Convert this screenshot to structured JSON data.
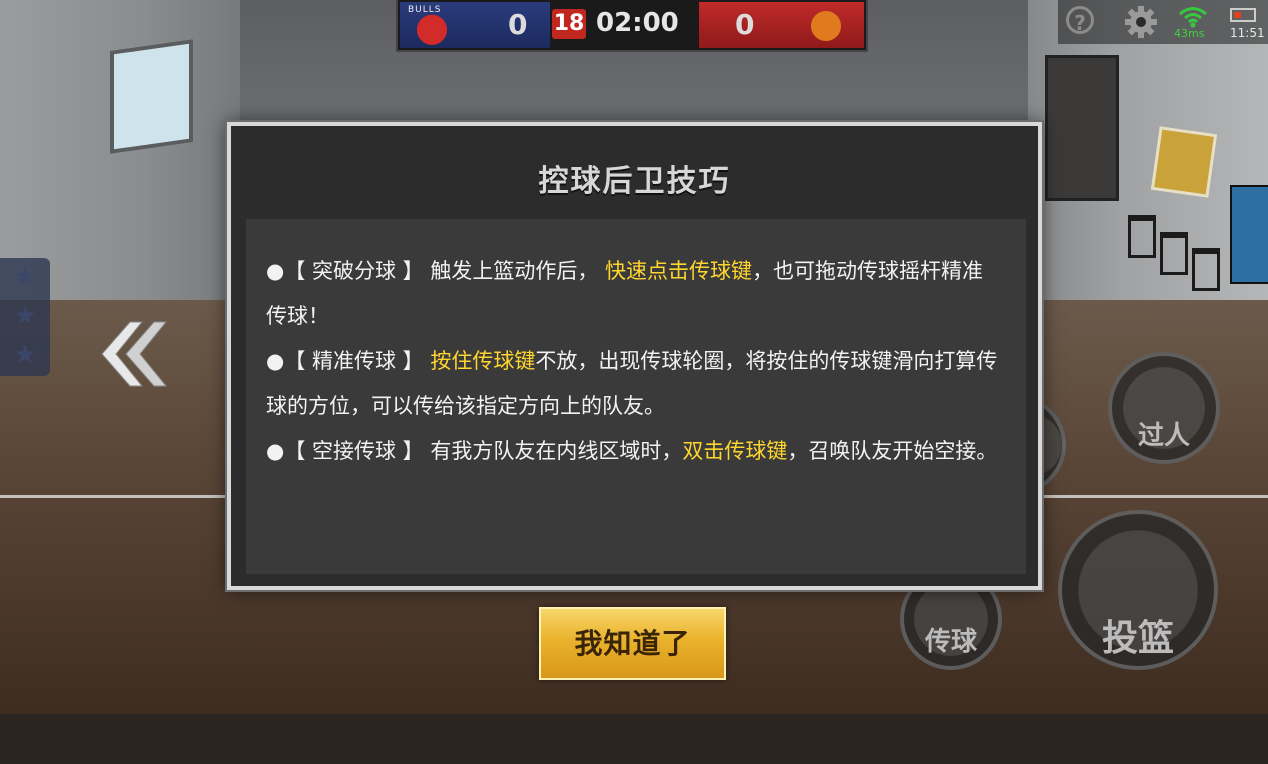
{
  "scoreboard": {
    "home_logo_text": "BULLS",
    "home_score": "0",
    "shot_clock": "18",
    "game_clock": "02:00",
    "away_score": "0"
  },
  "status": {
    "help_glyph": "?",
    "ping": "43ms",
    "time": "11:51",
    "battery_level": 0.4
  },
  "dialog": {
    "title": "控球后卫技巧",
    "tips": [
      {
        "bullet": "●",
        "name": "【 突破分球 】",
        "pre": " 触发上篮动作后，",
        "highlight": " 快速点击传球键",
        "post": "，也可拖动传球摇杆精准传球！"
      },
      {
        "bullet": "●",
        "name": "【 精准传球 】",
        "pre": " ",
        "highlight": "按住传球键",
        "post": "不放，出现传球轮圈，将按住的传球键滑向打算传球的方位，可以传给该指定方向上的队友。"
      },
      {
        "bullet": "●",
        "name": "【 空接传球 】",
        "pre": " 有我方队友在内线区域时，",
        "highlight": "双击传球键",
        "post": "，召唤队友开始空接。"
      }
    ]
  },
  "confirm_button": {
    "label": "我知道了"
  },
  "controls": {
    "breakthrough": "过人",
    "pass": "传球",
    "shoot": "投篮"
  },
  "colors": {
    "highlight": "#ffd62e",
    "button": "#e9b22c",
    "home": "#2b3c7c",
    "away": "#c02a2a"
  }
}
